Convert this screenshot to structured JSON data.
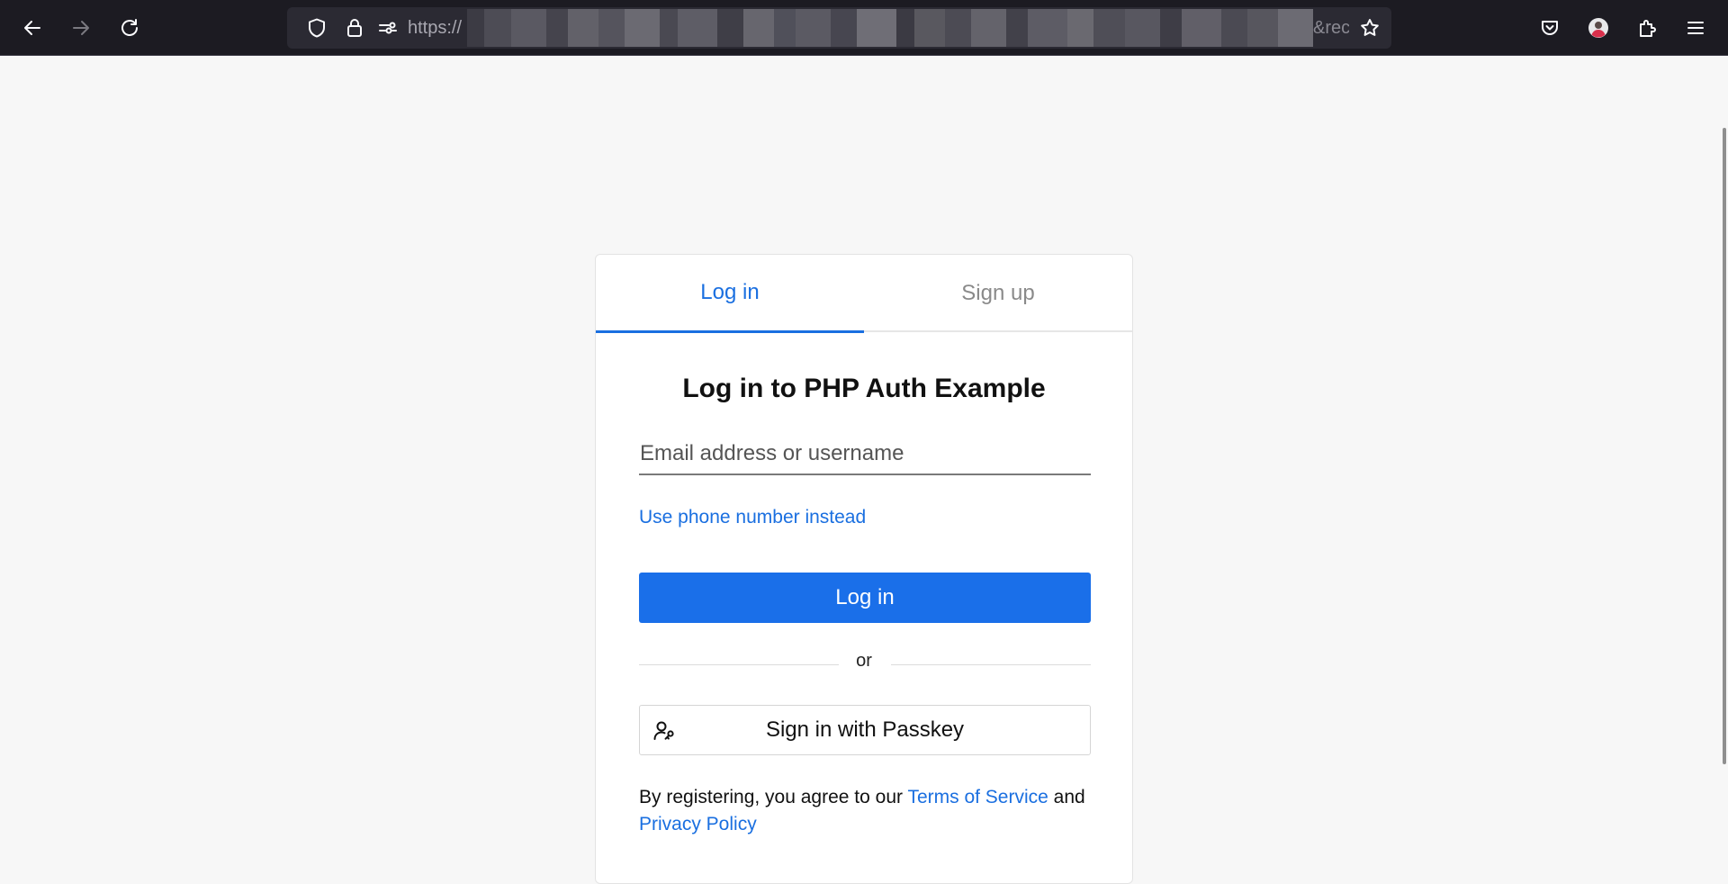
{
  "browser": {
    "url_prefix": "https://",
    "url_suffix": "&rec",
    "icons": {
      "back": "back-arrow-icon",
      "forward": "forward-arrow-icon",
      "reload": "reload-icon",
      "shield": "tracking-protection-shield-icon",
      "lock": "lock-icon",
      "permissions": "permissions-icon",
      "bookmark": "bookmark-star-icon",
      "pocket": "pocket-icon",
      "account": "account-avatar",
      "extensions": "extensions-icon",
      "menu": "hamburger-menu-icon"
    }
  },
  "tabs": [
    {
      "label": "Log in",
      "active": true
    },
    {
      "label": "Sign up",
      "active": false
    }
  ],
  "title": "Log in to PHP Auth Example",
  "email_field": {
    "placeholder": "Email address or username",
    "value": ""
  },
  "phone_link": "Use phone number instead",
  "login_button": "Log in",
  "divider": "or",
  "passkey_button": "Sign in with Passkey",
  "legal": {
    "prefix": "By registering, you agree to our ",
    "terms": "Terms of Service",
    "middle": " and",
    "privacy": "Privacy Policy"
  },
  "colors": {
    "accent": "#1a6fe0",
    "primary_button": "#1a6fe9",
    "page_background": "#f7f7f7",
    "toolbar_background": "#1c1b22"
  }
}
